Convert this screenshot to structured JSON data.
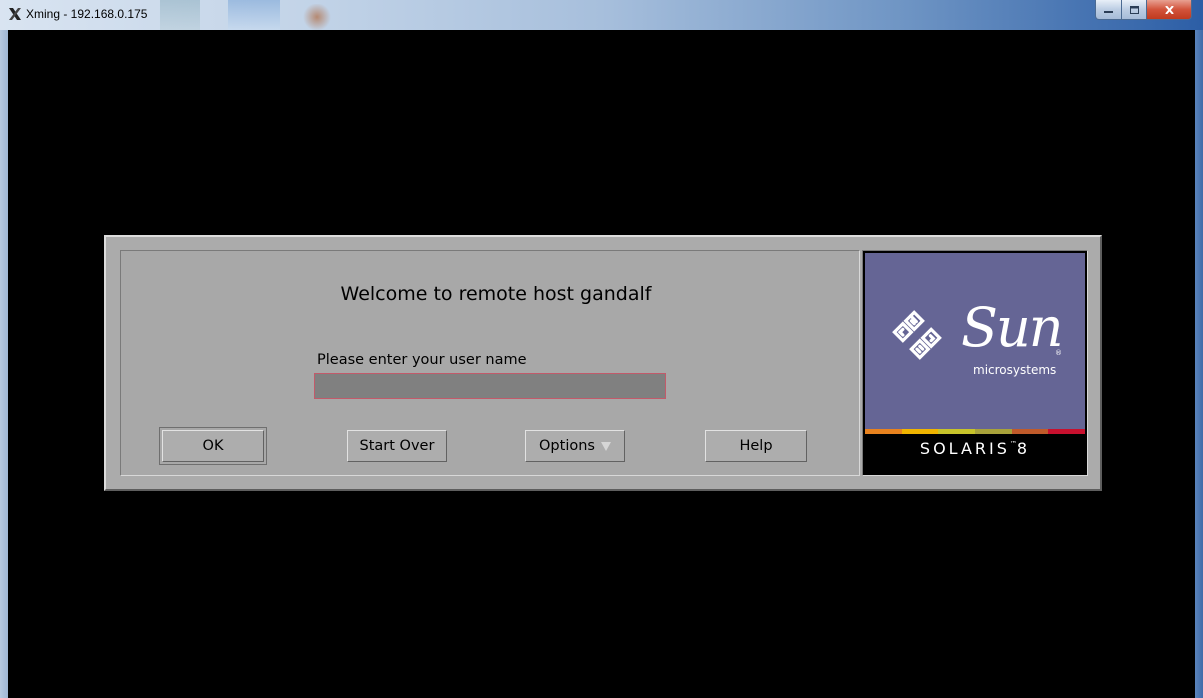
{
  "window": {
    "title": "Xming - 192.168.0.175",
    "icon": "x-icon",
    "controls": {
      "minimize": "minimize-icon",
      "maximize": "maximize-icon",
      "close": "close-icon"
    }
  },
  "dialog": {
    "welcome": "Welcome to remote host gandalf",
    "prompt": "Please enter your user name",
    "username_value": "",
    "buttons": {
      "ok": "OK",
      "start_over": "Start Over",
      "options": "Options",
      "help": "Help"
    }
  },
  "logo": {
    "brand": "Sun",
    "registered": "®",
    "subtitle": "microsystems",
    "product": "SOLARIS",
    "trademark": "™",
    "version": "8",
    "stripe_colors": [
      "#e8821e",
      "#f0b400",
      "#c7c32a",
      "#a8a23a",
      "#c05a2a",
      "#c8102e"
    ]
  },
  "colors": {
    "desktop": "#000000",
    "dialog": "#ababab",
    "logo_panel": "#656595"
  }
}
